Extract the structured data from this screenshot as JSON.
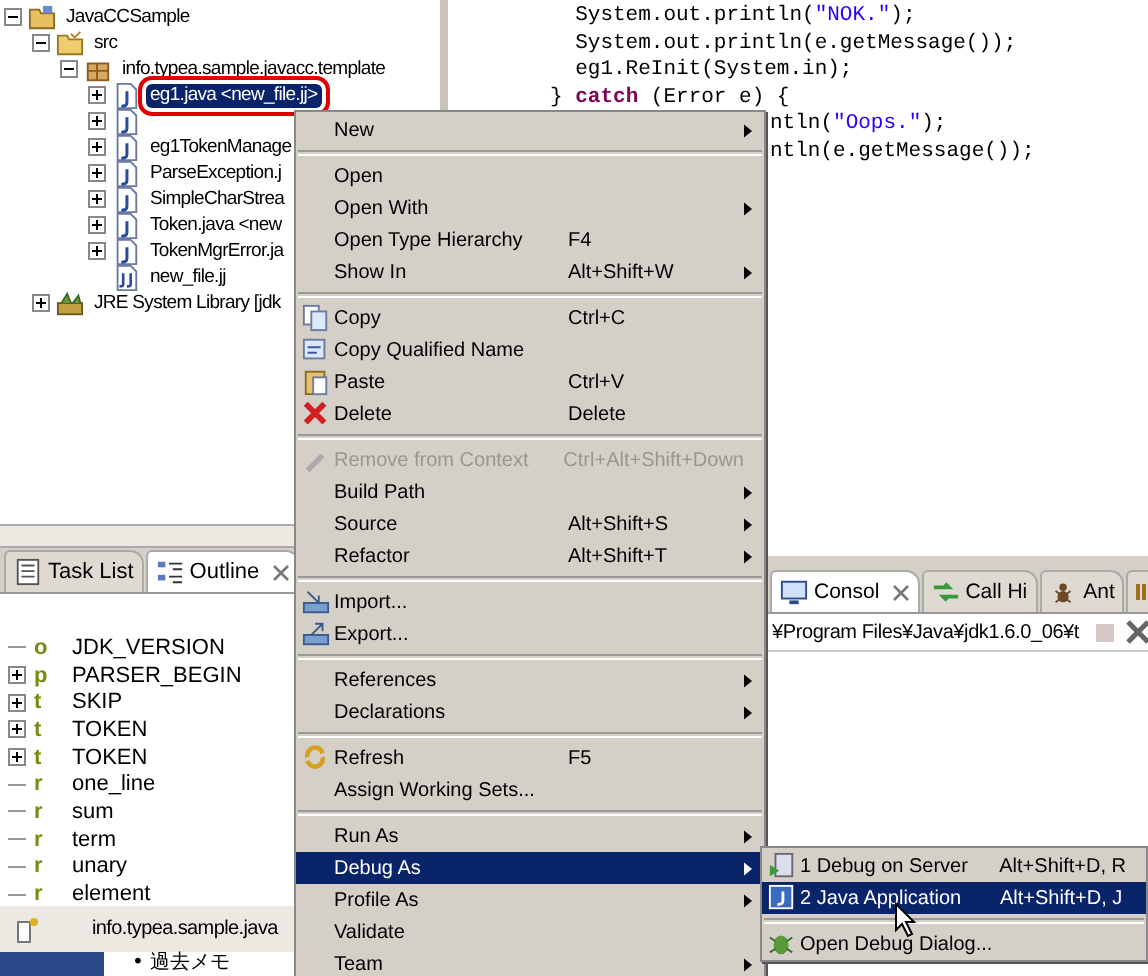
{
  "explorer": {
    "tree": [
      {
        "label": "JavaCCSample",
        "kind": "project",
        "expanded": true,
        "children": [
          {
            "label": "src",
            "kind": "folder",
            "expanded": true,
            "children": [
              {
                "label": "info.typea.sample.javacc.template",
                "kind": "package",
                "expanded": true,
                "children": [
                  {
                    "label": "eg1.java <new_file.jj>",
                    "kind": "java",
                    "expanded": false,
                    "selected": true,
                    "circled": true
                  },
                  {
                    "kind": "java",
                    "expanded": false,
                    "selected": false,
                    "circled": false
                  },
                  {
                    "label": "eg1TokenManage",
                    "kind": "java",
                    "expanded": false,
                    "selected": false,
                    "circled": false
                  },
                  {
                    "label": "ParseException.j",
                    "kind": "java",
                    "expanded": false,
                    "selected": false,
                    "circled": false
                  },
                  {
                    "label": "SimpleCharStrea",
                    "kind": "java",
                    "expanded": false,
                    "selected": false,
                    "circled": false
                  },
                  {
                    "label": "Token.java <new",
                    "kind": "java",
                    "expanded": false,
                    "selected": false,
                    "circled": false
                  },
                  {
                    "label": "TokenMgrError.ja",
                    "kind": "java",
                    "expanded": false,
                    "selected": false,
                    "circled": false
                  },
                  {
                    "label": "new_file.jj",
                    "kind": "jj",
                    "selected": false,
                    "circled": false
                  }
                ]
              }
            ]
          },
          {
            "label": "JRE System Library [jdk",
            "kind": "library",
            "expanded": false
          }
        ]
      }
    ]
  },
  "views": {
    "tabs": [
      {
        "label": "Task List",
        "kind": "tasks",
        "selected": false
      },
      {
        "label": "Outline",
        "kind": "outline",
        "selected": true
      }
    ]
  },
  "outline": [
    {
      "badge": "o",
      "label": "JDK_VERSION"
    },
    {
      "badge": "p",
      "label": "PARSER_BEGIN",
      "expanded": false
    },
    {
      "badge": "t",
      "label": "SKIP",
      "expanded": false
    },
    {
      "badge": "t",
      "label": "TOKEN",
      "expanded": false
    },
    {
      "badge": "t",
      "label": "TOKEN",
      "expanded": false
    },
    {
      "badge": "r",
      "label": "one_line"
    },
    {
      "badge": "r",
      "label": "sum"
    },
    {
      "badge": "r",
      "label": "term"
    },
    {
      "badge": "r",
      "label": "unary"
    },
    {
      "badge": "r",
      "label": "element"
    }
  ],
  "status_line": "info.typea.sample.java",
  "bottom_item": "• 過去メモ",
  "editor": {
    "lines": [
      {
        "segments": [
          {
            "kind": "plain",
            "text": "  System.out.println("
          },
          {
            "kind": "string",
            "text": "\"NOK.\""
          },
          {
            "kind": "plain",
            "text": ");"
          }
        ]
      },
      {
        "segments": [
          {
            "kind": "plain",
            "text": "  System.out.println(e.getMessage());"
          }
        ]
      },
      {
        "segments": [
          {
            "kind": "plain",
            "text": "  eg1.ReInit(System.in);"
          }
        ]
      },
      {
        "segments": [
          {
            "kind": "plain",
            "text": "} "
          },
          {
            "kind": "keyword",
            "text": "catch"
          },
          {
            "kind": "plain",
            "text": " (Error e) {"
          }
        ]
      },
      {
        "cut": true,
        "segments": [
          {
            "kind": "plain",
            "text": "ntln("
          },
          {
            "kind": "string",
            "text": "\"Oops.\""
          },
          {
            "kind": "plain",
            "text": ");"
          }
        ]
      },
      {
        "cut": true,
        "segments": [
          {
            "kind": "plain",
            "text": "ntln(e.getMessage());"
          }
        ]
      }
    ]
  },
  "console": {
    "tabs": [
      {
        "label": "Consol",
        "kind": "console",
        "selected": true
      },
      {
        "label": "Call Hi",
        "kind": "callhierarchy",
        "selected": false
      },
      {
        "label": "Ant",
        "kind": "ant",
        "selected": false
      }
    ],
    "path": "¥Program Files¥Java¥jdk1.6.0_06¥t"
  },
  "context_menu": {
    "items": [
      {
        "kind": "item",
        "label": "New",
        "submenu": true,
        "selected": false
      },
      {
        "kind": "separator"
      },
      {
        "kind": "item",
        "label": "Open",
        "selected": false
      },
      {
        "kind": "item",
        "label": "Open With",
        "submenu": true,
        "selected": false
      },
      {
        "kind": "item",
        "label": "Open Type Hierarchy",
        "shortcut": "F4",
        "selected": false
      },
      {
        "kind": "item",
        "label": "Show In",
        "shortcut": "Alt+Shift+W",
        "submenu": true,
        "selected": false
      },
      {
        "kind": "separator"
      },
      {
        "kind": "item",
        "label": "Copy",
        "shortcut": "Ctrl+C",
        "selected": false
      },
      {
        "kind": "item",
        "label": "Copy Qualified Name",
        "selected": false
      },
      {
        "kind": "item",
        "label": "Paste",
        "shortcut": "Ctrl+V",
        "selected": false
      },
      {
        "kind": "item",
        "label": "Delete",
        "shortcut": "Delete",
        "selected": false
      },
      {
        "kind": "separator"
      },
      {
        "kind": "item",
        "label": "Remove from Context",
        "shortcut": "Ctrl+Alt+Shift+Down",
        "disabled": true,
        "selected": false
      },
      {
        "kind": "item",
        "label": "Build Path",
        "submenu": true,
        "selected": false
      },
      {
        "kind": "item",
        "label": "Source",
        "shortcut": "Alt+Shift+S",
        "submenu": true,
        "selected": false
      },
      {
        "kind": "item",
        "label": "Refactor",
        "shortcut": "Alt+Shift+T",
        "submenu": true,
        "selected": false
      },
      {
        "kind": "separator"
      },
      {
        "kind": "item",
        "label": "Import...",
        "selected": false
      },
      {
        "kind": "item",
        "label": "Export...",
        "selected": false
      },
      {
        "kind": "separator"
      },
      {
        "kind": "item",
        "label": "References",
        "submenu": true,
        "selected": false
      },
      {
        "kind": "item",
        "label": "Declarations",
        "submenu": true,
        "selected": false
      },
      {
        "kind": "separator"
      },
      {
        "kind": "item",
        "label": "Refresh",
        "shortcut": "F5",
        "selected": false
      },
      {
        "kind": "item",
        "label": "Assign Working Sets...",
        "selected": false
      },
      {
        "kind": "separator"
      },
      {
        "kind": "item",
        "label": "Run As",
        "submenu": true,
        "selected": false
      },
      {
        "kind": "item",
        "label": "Debug As",
        "submenu": true,
        "selected": true
      },
      {
        "kind": "item",
        "label": "Profile As",
        "submenu": true,
        "selected": false
      },
      {
        "kind": "item",
        "label": "Validate",
        "selected": false
      },
      {
        "kind": "item",
        "label": "Team",
        "submenu": true,
        "selected": false
      }
    ]
  },
  "submenu": {
    "items": [
      {
        "kind": "item",
        "label": "1 Debug on Server",
        "shortcut": "Alt+Shift+D, R",
        "selected": false
      },
      {
        "kind": "item",
        "label": "2 Java Application",
        "shortcut": "Alt+Shift+D, J",
        "selected": true
      },
      {
        "kind": "separator"
      },
      {
        "kind": "item",
        "label": "Open Debug Dialog...",
        "selected": false
      }
    ]
  }
}
